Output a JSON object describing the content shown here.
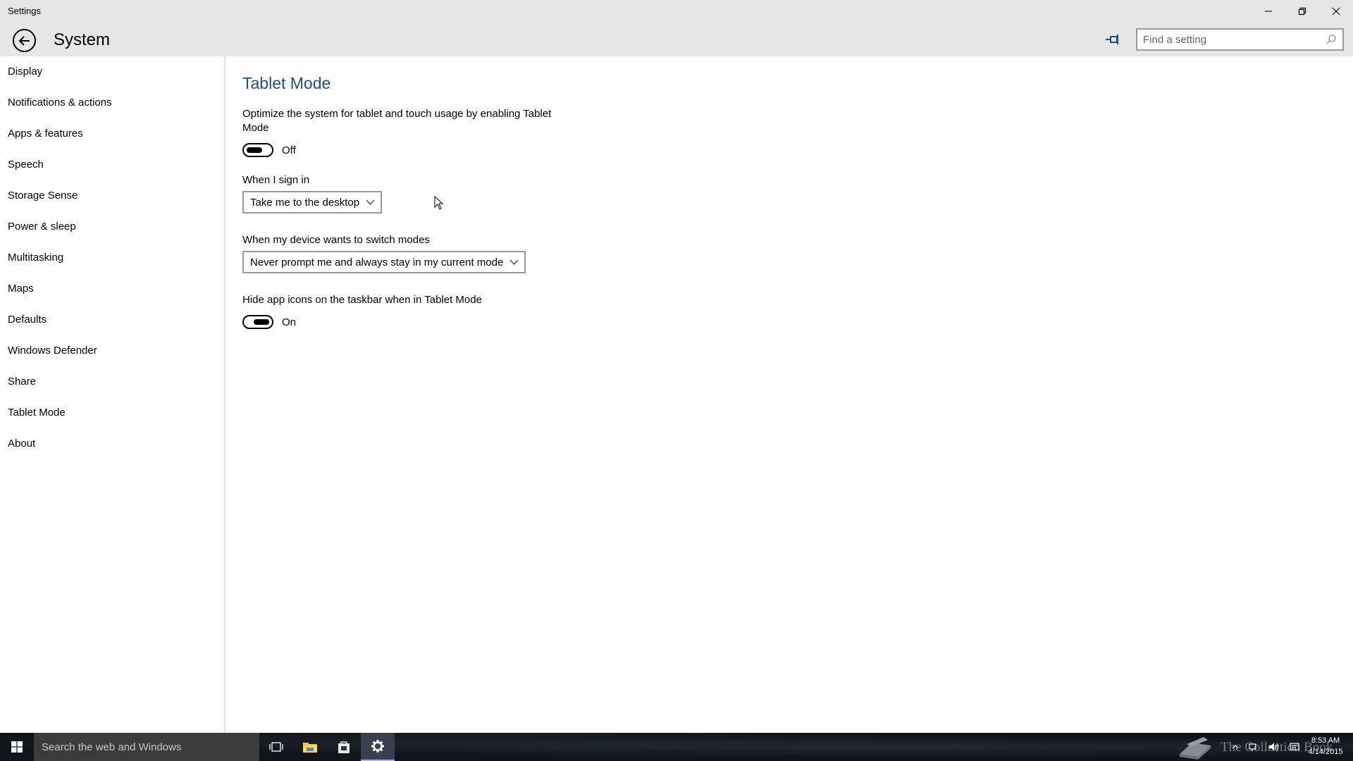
{
  "window": {
    "title": "Settings",
    "page_header": "System"
  },
  "search": {
    "placeholder": "Find a setting"
  },
  "sidebar": {
    "items": [
      {
        "label": "Display"
      },
      {
        "label": "Notifications & actions"
      },
      {
        "label": "Apps & features"
      },
      {
        "label": "Speech"
      },
      {
        "label": "Storage Sense"
      },
      {
        "label": "Power & sleep"
      },
      {
        "label": "Multitasking"
      },
      {
        "label": "Maps"
      },
      {
        "label": "Defaults"
      },
      {
        "label": "Windows Defender"
      },
      {
        "label": "Share"
      },
      {
        "label": "Tablet Mode"
      },
      {
        "label": "About"
      }
    ],
    "selected": "Tablet Mode"
  },
  "content": {
    "title": "Tablet Mode",
    "tablet_mode_description": "Optimize the system for tablet and touch usage by enabling Tablet Mode",
    "tablet_mode_toggle": {
      "state_label": "Off",
      "on": false
    },
    "sign_in_label": "When I sign in",
    "sign_in_value": "Take me to the desktop",
    "switch_modes_label": "When my device wants to switch modes",
    "switch_modes_value": "Never prompt me and always stay in my current mode",
    "hide_icons_label": "Hide app icons on the taskbar when in Tablet Mode",
    "hide_icons_toggle": {
      "state_label": "On",
      "on": true
    }
  },
  "taskbar": {
    "search_placeholder": "Search the web and Windows",
    "watermark_text": "The Collection Book",
    "clock_time": "8:53 AM",
    "clock_date": "4/14/2015",
    "active_app": "settings"
  },
  "colors": {
    "accent": "#1e4f7d",
    "header_bg": "#e6e6e6",
    "taskbar_bg": "#10131a",
    "taskbar_search_bg": "#3b3b3b"
  }
}
